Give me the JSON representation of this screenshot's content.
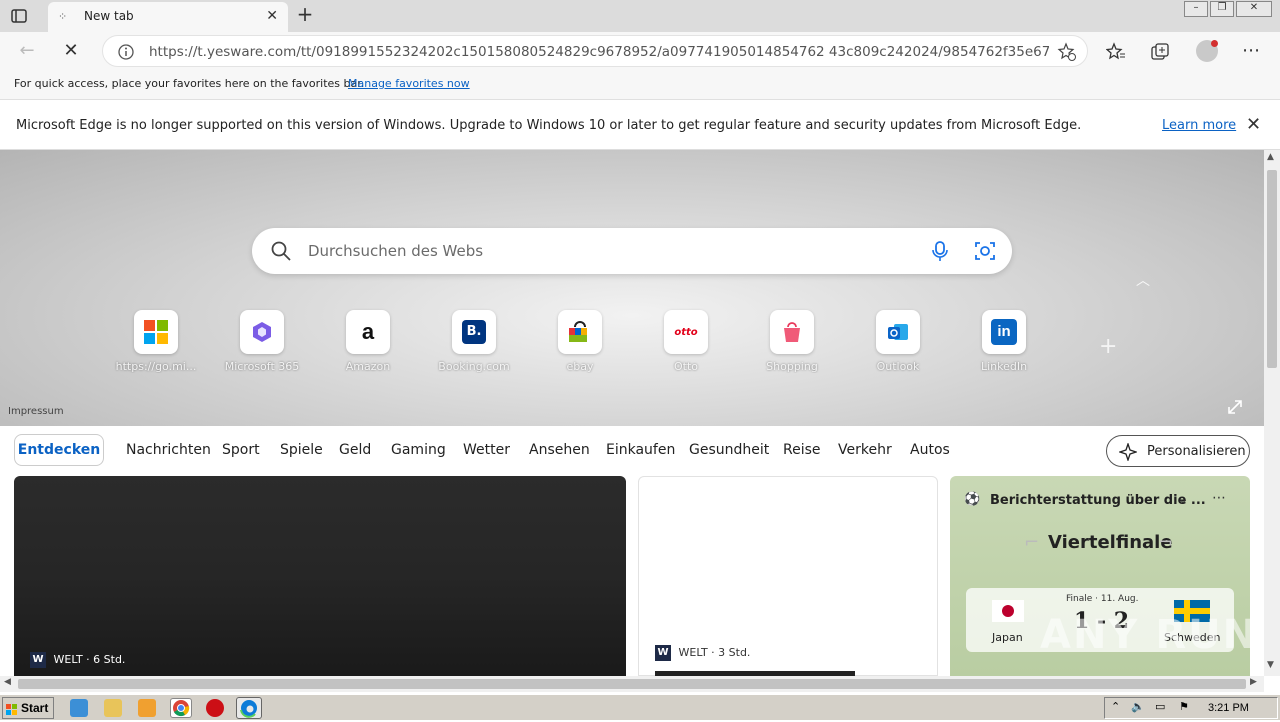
{
  "tab": {
    "title": "New tab"
  },
  "address": {
    "url": "https://t.yesware.com/tt/0918991552324202c150158080524829c9678952/a097741905014854762 43c809c242024/9854762f35e6789edb50..."
  },
  "favorites_bar": {
    "message": "For quick access, place your favorites here on the favorites bar.",
    "link": "Manage favorites now"
  },
  "info_bar": {
    "message": "Microsoft Edge is no longer supported on this version of Windows. Upgrade to Windows 10 or later to get regular feature and security updates from Microsoft Edge.",
    "link": "Learn more"
  },
  "search": {
    "placeholder": "Durchsuchen des Webs"
  },
  "tiles": [
    {
      "label": "https://go.mi...",
      "icon": "microsoft-icon"
    },
    {
      "label": "Microsoft 365",
      "icon": "microsoft365-icon"
    },
    {
      "label": "Amazon",
      "icon": "amazon-icon"
    },
    {
      "label": "Booking.com",
      "icon": "booking-icon"
    },
    {
      "label": "ebay",
      "icon": "ebay-icon"
    },
    {
      "label": "Otto",
      "icon": "otto-icon"
    },
    {
      "label": "Shopping",
      "icon": "shopping-icon"
    },
    {
      "label": "Outlook",
      "icon": "outlook-icon"
    },
    {
      "label": "LinkedIn",
      "icon": "linkedin-icon"
    }
  ],
  "impressum": "Impressum",
  "feed": {
    "active": "Entdecken",
    "categories": [
      "Nachrichten",
      "Sport",
      "Spiele",
      "Geld",
      "Gaming",
      "Wetter",
      "Ansehen",
      "Einkaufen",
      "Gesundheit",
      "Reise",
      "Verkehr",
      "Autos"
    ],
    "personalize": "Personalisieren"
  },
  "cards": {
    "card1": {
      "source": "WELT · 6 Std."
    },
    "card2": {
      "source": "WELT · 3 Std."
    },
    "card3": {
      "title": "Berichterstattung über die ...",
      "stage": "Viertelfinale",
      "status": "Finale · 11. Aug.",
      "team1": "Japan",
      "team2": "Schweden",
      "score": "1 - 2"
    }
  },
  "taskbar": {
    "start": "Start",
    "clock": "3:21 PM"
  },
  "watermark": "ANY RUN"
}
